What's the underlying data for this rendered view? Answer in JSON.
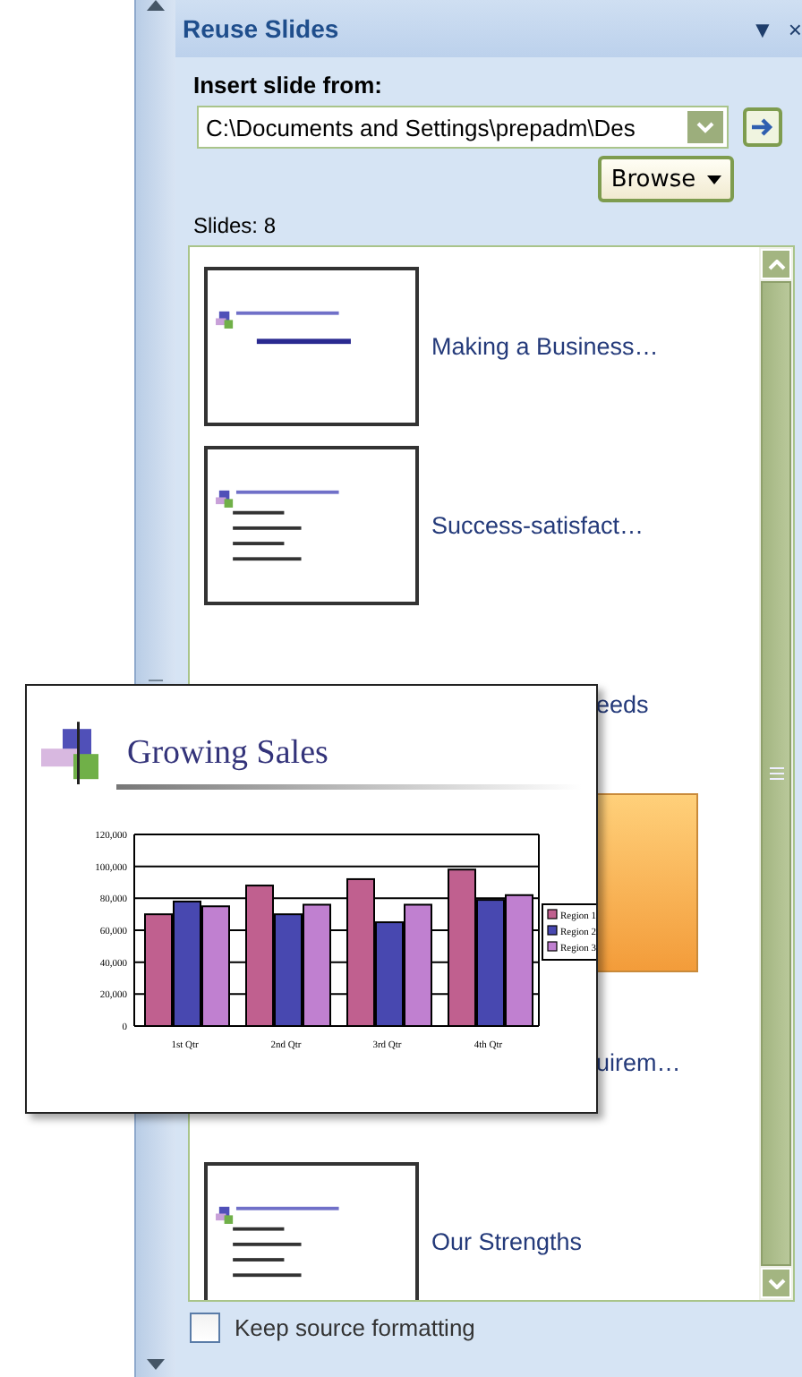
{
  "panel": {
    "title": "Reuse Slides",
    "menu_glyph": "▼",
    "close_glyph": "×"
  },
  "insert": {
    "label": "Insert slide from:",
    "path": "C:\\Documents and Settings\\prepadm\\Des",
    "browse": "Browse"
  },
  "slides_count": "Slides: 8",
  "slides": [
    {
      "kind": "title-slide",
      "title": "Making a Business…",
      "selected": false
    },
    {
      "kind": "bullet-slide",
      "title": "Success-satisfact…",
      "selected": false
    },
    {
      "kind": "covered",
      "title": "eeds",
      "selected": false
    },
    {
      "kind": "covered",
      "selected": true
    },
    {
      "kind": "covered",
      "title": "uirem…",
      "selected": false
    },
    {
      "kind": "bullet-slide",
      "title": "Our Strengths",
      "selected": false
    }
  ],
  "keep_formatting": {
    "label": "Keep source formatting",
    "checked": false
  },
  "preview": {
    "title": "Growing Sales",
    "chart_data": {
      "type": "bar",
      "grid": true,
      "legend": true,
      "categories": [
        "1st Qtr",
        "2nd Qtr",
        "3rd Qtr",
        "4th Qtr"
      ],
      "ylim": [
        0,
        120000
      ],
      "yticks": [
        {
          "value": 0,
          "label": "0"
        },
        {
          "value": 20000,
          "label": "20,000"
        },
        {
          "value": 40000,
          "label": "40,000"
        },
        {
          "value": 60000,
          "label": "60,000"
        },
        {
          "value": 80000,
          "label": "80,000"
        },
        {
          "value": 100000,
          "label": "100,000"
        },
        {
          "value": 120000,
          "label": "120,000"
        }
      ],
      "series": [
        {
          "name": "Region 1",
          "color": "#c0608f",
          "values": [
            70000,
            88000,
            92000,
            98000
          ]
        },
        {
          "name": "Region 2",
          "color": "#4848b0",
          "values": [
            78000,
            70000,
            65000,
            79000
          ]
        },
        {
          "name": "Region 3",
          "color": "#c080d0",
          "values": [
            75000,
            76000,
            76000,
            82000
          ]
        }
      ]
    }
  }
}
